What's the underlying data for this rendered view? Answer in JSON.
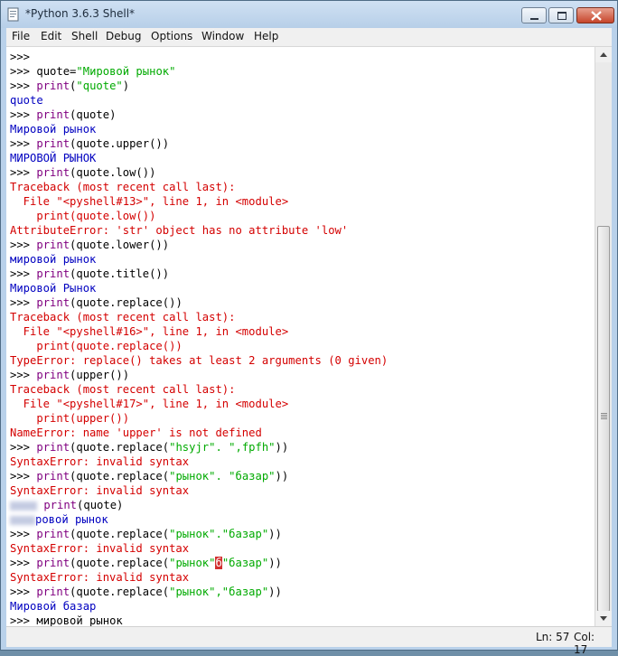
{
  "window": {
    "title": "*Python 3.6.3 Shell*"
  },
  "menu": [
    "File",
    "Edit",
    "Shell",
    "Debug",
    "Options",
    "Window",
    "Help"
  ],
  "lines": [
    [
      {
        "t": ">>>",
        "c": "p"
      }
    ],
    [
      {
        "t": ">>> ",
        "c": "p"
      },
      {
        "t": "quote=",
        "c": "c"
      },
      {
        "t": "\"Мировой рынок\"",
        "c": "s"
      }
    ],
    [
      {
        "t": ">>> ",
        "c": "p"
      },
      {
        "t": "print",
        "c": "b"
      },
      {
        "t": "(",
        "c": "c"
      },
      {
        "t": "\"quote\"",
        "c": "s"
      },
      {
        "t": ")",
        "c": "c"
      }
    ],
    [
      {
        "t": "quote",
        "c": "o"
      }
    ],
    [
      {
        "t": ">>> ",
        "c": "p"
      },
      {
        "t": "print",
        "c": "b"
      },
      {
        "t": "(quote)",
        "c": "c"
      }
    ],
    [
      {
        "t": "Мировой рынок",
        "c": "o"
      }
    ],
    [
      {
        "t": ">>> ",
        "c": "p"
      },
      {
        "t": "print",
        "c": "b"
      },
      {
        "t": "(quote.upper())",
        "c": "c"
      }
    ],
    [
      {
        "t": "МИРОВОЙ РЫНОК",
        "c": "o"
      }
    ],
    [
      {
        "t": ">>> ",
        "c": "p"
      },
      {
        "t": "print",
        "c": "b"
      },
      {
        "t": "(quote.low())",
        "c": "c"
      }
    ],
    [
      {
        "t": "Traceback (most recent call last):",
        "c": "e"
      }
    ],
    [
      {
        "t": "  File \"<pyshell#13>\", line 1, in <module>",
        "c": "e"
      }
    ],
    [
      {
        "t": "    print(quote.low())",
        "c": "e"
      }
    ],
    [
      {
        "t": "AttributeError: 'str' object has no attribute 'low'",
        "c": "e"
      }
    ],
    [
      {
        "t": ">>> ",
        "c": "p"
      },
      {
        "t": "print",
        "c": "b"
      },
      {
        "t": "(quote.lower())",
        "c": "c"
      }
    ],
    [
      {
        "t": "мировой рынок",
        "c": "o"
      }
    ],
    [
      {
        "t": ">>> ",
        "c": "p"
      },
      {
        "t": "print",
        "c": "b"
      },
      {
        "t": "(quote.title())",
        "c": "c"
      }
    ],
    [
      {
        "t": "Мировой Рынок",
        "c": "o"
      }
    ],
    [
      {
        "t": ">>> ",
        "c": "p"
      },
      {
        "t": "print",
        "c": "b"
      },
      {
        "t": "(quote.replace())",
        "c": "c"
      }
    ],
    [
      {
        "t": "Traceback (most recent call last):",
        "c": "e"
      }
    ],
    [
      {
        "t": "  File \"<pyshell#16>\", line 1, in <module>",
        "c": "e"
      }
    ],
    [
      {
        "t": "    print(quote.replace())",
        "c": "e"
      }
    ],
    [
      {
        "t": "TypeError: replace() takes at least 2 arguments (0 given)",
        "c": "e"
      }
    ],
    [
      {
        "t": ">>> ",
        "c": "p"
      },
      {
        "t": "print",
        "c": "b"
      },
      {
        "t": "(upper())",
        "c": "c"
      }
    ],
    [
      {
        "t": "Traceback (most recent call last):",
        "c": "e"
      }
    ],
    [
      {
        "t": "  File \"<pyshell#17>\", line 1, in <module>",
        "c": "e"
      }
    ],
    [
      {
        "t": "    print(upper())",
        "c": "e"
      }
    ],
    [
      {
        "t": "NameError: name 'upper' is not defined",
        "c": "e"
      }
    ],
    [
      {
        "t": ">>> ",
        "c": "p"
      },
      {
        "t": "print",
        "c": "b"
      },
      {
        "t": "(quote.replace(",
        "c": "c"
      },
      {
        "t": "\"hsyjr\". \",fpfh\"",
        "c": "s"
      },
      {
        "t": "))",
        "c": "c"
      }
    ],
    [
      {
        "t": "SyntaxError: invalid syntax",
        "c": "e"
      }
    ],
    [
      {
        "t": ">>> ",
        "c": "p"
      },
      {
        "t": "print",
        "c": "b"
      },
      {
        "t": "(quote.replace(",
        "c": "c"
      },
      {
        "t": "\"рынок\". \"базар\"",
        "c": "s"
      },
      {
        "t": "))",
        "c": "c"
      }
    ],
    [
      {
        "t": "SyntaxError: invalid syntax",
        "c": "e"
      }
    ],
    [
      {
        "t": "",
        "c": "blur"
      },
      {
        "t": " print",
        "c": "b"
      },
      {
        "t": "(quote)",
        "c": "c"
      }
    ],
    [
      {
        "t": "",
        "c": "blur small"
      },
      {
        "t": "ровой рынок",
        "c": "o"
      }
    ],
    [
      {
        "t": ">>> ",
        "c": "p"
      },
      {
        "t": "print",
        "c": "b"
      },
      {
        "t": "(quote.replace(",
        "c": "c"
      },
      {
        "t": "\"рынок\".\"базар\"",
        "c": "s"
      },
      {
        "t": "))",
        "c": "c"
      }
    ],
    [
      {
        "t": "SyntaxError: invalid syntax",
        "c": "e"
      }
    ],
    [
      {
        "t": ">>> ",
        "c": "p"
      },
      {
        "t": "print",
        "c": "b"
      },
      {
        "t": "(quote.replace(",
        "c": "c"
      },
      {
        "t": "\"рынок\"",
        "c": "s"
      },
      {
        "t": "б",
        "c": "cursor"
      },
      {
        "t": "\"базар\"",
        "c": "s"
      },
      {
        "t": "))",
        "c": "c"
      }
    ],
    [
      {
        "t": "SyntaxError: invalid syntax",
        "c": "e"
      }
    ],
    [
      {
        "t": ">>> ",
        "c": "p"
      },
      {
        "t": "print",
        "c": "b"
      },
      {
        "t": "(quote.replace(",
        "c": "c"
      },
      {
        "t": "\"рынок\",\"базар\"",
        "c": "s"
      },
      {
        "t": "))",
        "c": "c"
      }
    ],
    [
      {
        "t": "Мировой базар",
        "c": "o"
      }
    ],
    [
      {
        "t": ">>> ",
        "c": "p"
      },
      {
        "t": "мировой рынок",
        "c": "c"
      }
    ]
  ],
  "status": {
    "ln": "Ln: 57",
    "col": "Col: 17"
  }
}
